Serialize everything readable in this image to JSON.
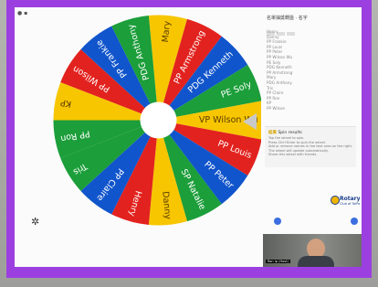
{
  "wheel": {
    "segments": [
      {
        "label": "Mary",
        "color": "#f7c600"
      },
      {
        "label": "PP Armstrong",
        "color": "#e2221e"
      },
      {
        "label": "PDG Kenneth",
        "color": "#1155cc"
      },
      {
        "label": "PE Soly",
        "color": "#1c9e3a"
      },
      {
        "label": "VP Wilson Wu",
        "color": "#f7c600"
      },
      {
        "label": "PP Louis",
        "color": "#e2221e"
      },
      {
        "label": "PP Peter",
        "color": "#1155cc"
      },
      {
        "label": "SP Natalie",
        "color": "#1c9e3a"
      },
      {
        "label": "Danny",
        "color": "#f7c600"
      },
      {
        "label": "Henry",
        "color": "#e2221e"
      },
      {
        "label": "PP Claire",
        "color": "#1155cc"
      },
      {
        "label": "Tris",
        "color": "#1c9e3a"
      },
      {
        "label": "PP Ron",
        "color": "#1c9e3a"
      },
      {
        "label": "KP",
        "color": "#f7c600"
      },
      {
        "label": "PP Wilson",
        "color": "#e2221e"
      },
      {
        "label": "PP Frankie",
        "color": "#1155cc"
      },
      {
        "label": "PDG Anthony",
        "color": "#1c9e3a"
      }
    ]
  },
  "panel": {
    "title": "名單抽獎轉盤 · 名字",
    "names": [
      "Henry",
      "Danny",
      "PP Frankie",
      "PP Louis",
      "PP Peter",
      "PP Wilson Wu",
      "PE Soly",
      "PDG Kenneth",
      "PP Armstrong",
      "Mary",
      "PDG Anthony",
      "Tris",
      "PP Claire",
      "PP Ron",
      "KP",
      "PP Wilson"
    ],
    "results_label": "結果",
    "results_title": "Spin results",
    "results_lines": [
      "Tap the wheel to spin.",
      "Press Ctrl+Enter to spin the wheel.",
      "Add or remove names in the text area on the right.",
      "The wheel will update automatically.",
      "Share this wheel with friends."
    ]
  },
  "logo": {
    "name": "Rotary",
    "club": "Club of TaiPo"
  },
  "video": {
    "name_tag": "Ron Ip (Host)"
  }
}
